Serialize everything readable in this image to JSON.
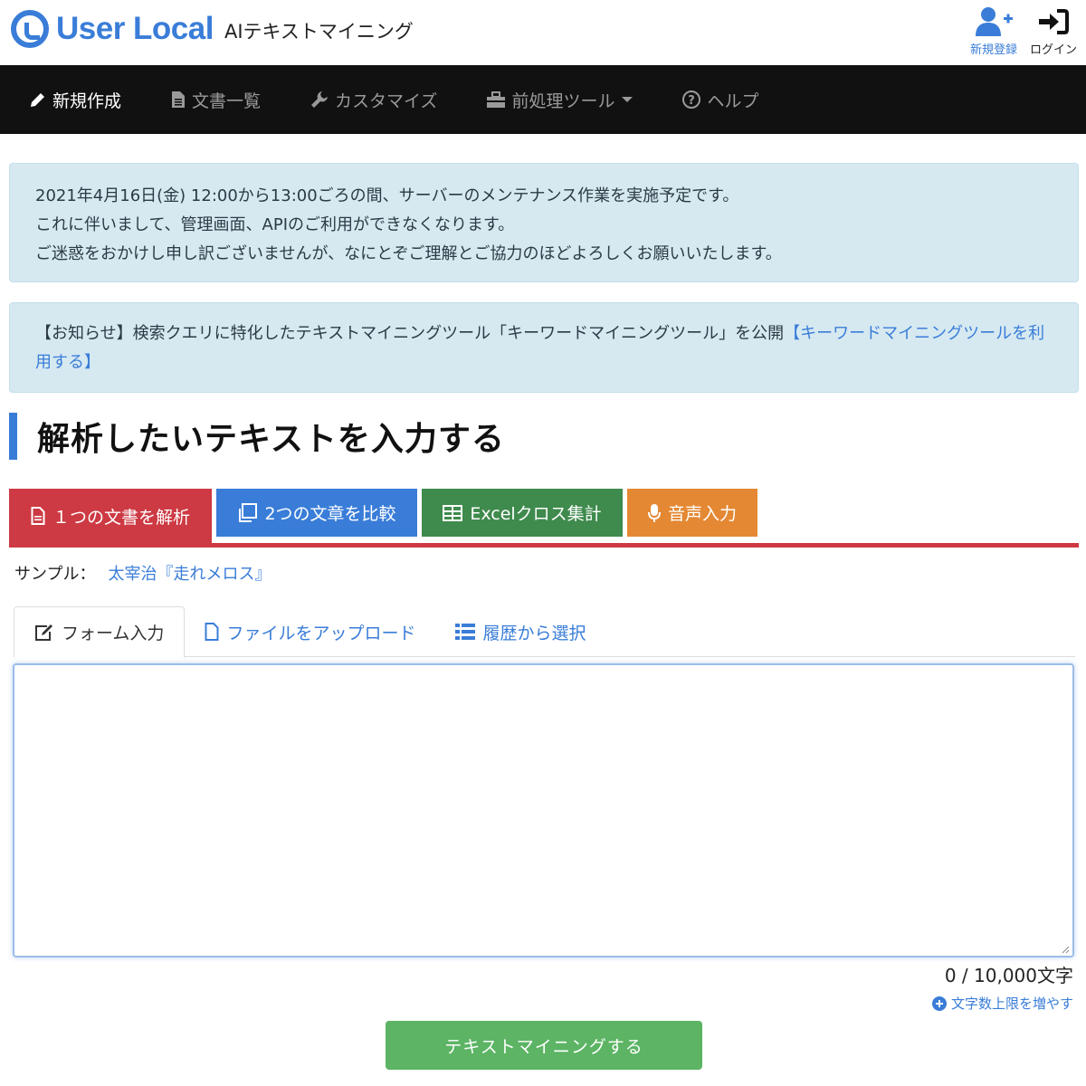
{
  "brand": {
    "name": "User Local",
    "product": "AIテキストマイニング"
  },
  "user_links": {
    "signup": "新規登録",
    "login": "ログイン"
  },
  "nav": {
    "items": [
      {
        "label": "新規作成",
        "icon": "pencil-icon"
      },
      {
        "label": "文書一覧",
        "icon": "document-icon"
      },
      {
        "label": "カスタマイズ",
        "icon": "wrench-icon"
      },
      {
        "label": "前処理ツール",
        "icon": "toolbox-icon"
      },
      {
        "label": "ヘルプ",
        "icon": "question-circle-icon"
      }
    ]
  },
  "alerts": {
    "maintenance": [
      "2021年4月16日(金) 12:00から13:00ごろの間、サーバーのメンテナンス作業を実施予定です。",
      "これに伴いまして、管理画面、APIのご利用ができなくなります。",
      "ご迷惑をおかけし申し訳ございませんが、なにとぞご理解とご協力のほどよろしくお願いいたします。"
    ],
    "notice_text": "【お知らせ】検索クエリに特化したテキストマイニングツール「キーワードマイニングツール」を公開",
    "notice_link": "【キーワードマイニングツールを利用する】"
  },
  "heading": "解析したいテキストを入力する",
  "modes": [
    {
      "label": "１つの文書を解析",
      "icon": "document-icon"
    },
    {
      "label": "2つの文章を比較",
      "icon": "copy-icon"
    },
    {
      "label": "Excelクロス集計",
      "icon": "table-icon"
    },
    {
      "label": "音声入力",
      "icon": "microphone-icon"
    }
  ],
  "sample": {
    "label": "サンプル：",
    "link": "太宰治『走れメロス』"
  },
  "input_tabs": [
    {
      "label": "フォーム入力",
      "icon": "edit-icon"
    },
    {
      "label": "ファイルをアップロード",
      "icon": "file-icon"
    },
    {
      "label": "履歴から選択",
      "icon": "list-icon"
    }
  ],
  "textarea": {
    "value": ""
  },
  "counter": "0 / 10,000文字",
  "increase_limit": "文字数上限を増やす",
  "submit": "テキストマイニングする",
  "colors": {
    "accent": "#3a7dd8",
    "nav_bg": "#111111",
    "alert_bg": "#d6e9f1",
    "mode_red": "#cd3a43",
    "mode_blue": "#3a7dd8",
    "mode_green": "#3f8a4d",
    "mode_orange": "#e48833",
    "submit_green": "#5cb464"
  }
}
